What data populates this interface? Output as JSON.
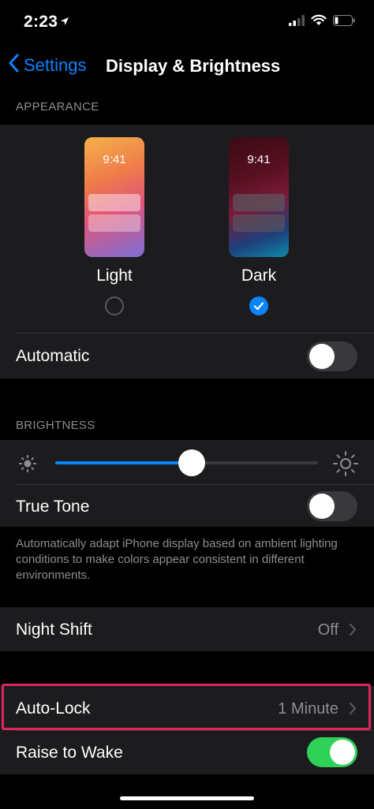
{
  "status_bar": {
    "time": "2:23"
  },
  "nav": {
    "back_label": "Settings",
    "title": "Display & Brightness"
  },
  "appearance": {
    "header": "APPEARANCE",
    "light": {
      "time": "9:41",
      "label": "Light",
      "selected": false
    },
    "dark": {
      "time": "9:41",
      "label": "Dark",
      "selected": true
    },
    "automatic_label": "Automatic",
    "automatic_on": false
  },
  "brightness": {
    "header": "BRIGHTNESS",
    "level": 0.52,
    "true_tone_label": "True Tone",
    "true_tone_on": false,
    "footer": "Automatically adapt iPhone display based on ambient lighting conditions to make colors appear consistent in different environments."
  },
  "night_shift": {
    "label": "Night Shift",
    "value": "Off"
  },
  "auto_lock": {
    "label": "Auto-Lock",
    "value": "1 Minute"
  },
  "raise_to_wake": {
    "label": "Raise to Wake",
    "on": true
  },
  "colors": {
    "accent": "#0a84ff",
    "toggle_on": "#30d158",
    "highlight": "#e0245e"
  }
}
